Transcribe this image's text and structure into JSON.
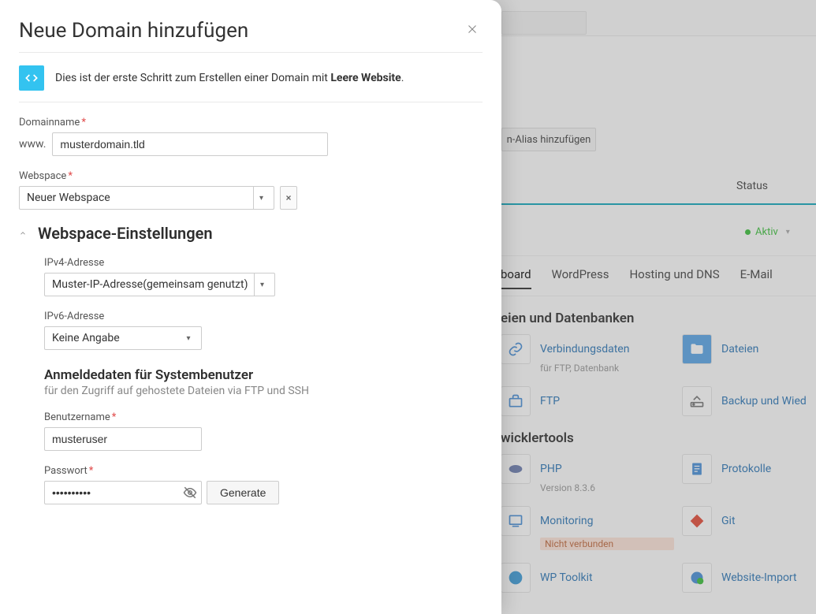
{
  "modal": {
    "title": "Neue Domain hinzufügen",
    "description_pre": "Dies ist der erste Schritt zum Erstellen einer Domain mit ",
    "description_bold": "Leere Website",
    "description_post": ".",
    "domain_label": "Domainname",
    "domain_prefix": "www.",
    "domain_value": "musterdomain.tld",
    "webspace_label": "Webspace",
    "webspace_value": "Neuer Webspace",
    "webspace_settings_heading": "Webspace-Einstellungen",
    "ipv4_label": "IPv4-Adresse",
    "ipv4_value": "Muster-IP-Adresse(gemeinsam genutzt)",
    "ipv6_label": "IPv6-Adresse",
    "ipv6_value": "Keine Angabe",
    "creds_heading": "Anmeldedaten für Systembenutzer",
    "creds_desc": "für den Zugriff auf gehostete Dateien via FTP und SSH",
    "username_label": "Benutzername",
    "username_value": "musteruser",
    "password_label": "Passwort",
    "password_value": "••••••••••",
    "generate_label": "Generate"
  },
  "bg": {
    "add_alias_btn": "n-Alias hinzufügen",
    "status_header": "Status",
    "status_value": "Aktiv",
    "tabs": {
      "dashboard": "board",
      "wordpress": "WordPress",
      "hosting": "Hosting und DNS",
      "email": "E-Mail"
    },
    "section_files_db": "eien und Datenbanken",
    "items": {
      "verbindung": "Verbindungsdaten",
      "verbindung_sub": "für FTP, Datenbank",
      "dateien": "Dateien",
      "ftp": "FTP",
      "backup": "Backup und Wied",
      "section_dev": "wicklertools",
      "php": "PHP",
      "php_sub": "Version 8.3.6",
      "protokolle": "Protokolle",
      "monitoring": "Monitoring",
      "monitoring_badge": "Nicht verbunden",
      "git": "Git",
      "wptoolkit": "WP Toolkit",
      "import": "Website-Import"
    }
  }
}
